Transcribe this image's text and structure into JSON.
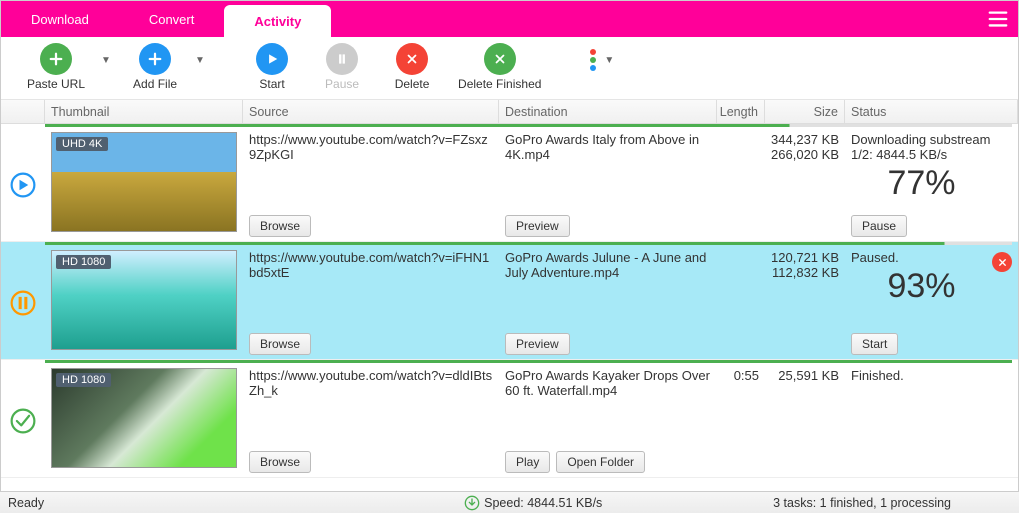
{
  "tabs": {
    "download": "Download",
    "convert": "Convert",
    "activity": "Activity"
  },
  "toolbar": {
    "pasteUrl": "Paste URL",
    "addFile": "Add File",
    "start": "Start",
    "pause": "Pause",
    "delete": "Delete",
    "deleteFinished": "Delete Finished"
  },
  "headers": {
    "thumbnail": "Thumbnail",
    "source": "Source",
    "destination": "Destination",
    "length": "Length",
    "size": "Size",
    "status": "Status"
  },
  "rows": [
    {
      "badge": "UHD 4K",
      "source": "https://www.youtube.com/watch?v=FZsxz9ZpKGI",
      "dest": "GoPro Awards  Italy from Above in 4K.mp4",
      "length": "",
      "size1": "344,237 KB",
      "size2": "266,020 KB",
      "statusText": "Downloading substream 1/2: 4844.5 KB/s",
      "pct": "77%",
      "browse": "Browse",
      "preview": "Preview",
      "action": "Pause",
      "progress": 77,
      "state": "playing",
      "selected": false
    },
    {
      "badge": "HD 1080",
      "source": "https://www.youtube.com/watch?v=iFHN1bd5xtE",
      "dest": "GoPro Awards  Julune - A June and July Adventure.mp4",
      "length": "",
      "size1": "120,721 KB",
      "size2": "112,832 KB",
      "statusText": "Paused.",
      "pct": "93%",
      "browse": "Browse",
      "preview": "Preview",
      "action": "Start",
      "progress": 93,
      "state": "paused",
      "selected": true
    },
    {
      "badge": "HD 1080",
      "source": "https://www.youtube.com/watch?v=dldIBtsZh_k",
      "dest": "GoPro Awards  Kayaker Drops Over 60 ft. Waterfall.mp4",
      "length": "0:55",
      "size1": "25,591 KB",
      "size2": "",
      "statusText": "Finished.",
      "pct": "",
      "browse": "Browse",
      "play": "Play",
      "openFolder": "Open Folder",
      "progress": 100,
      "state": "done",
      "selected": false
    }
  ],
  "statusbar": {
    "ready": "Ready",
    "speed": "Speed: 4844.51 KB/s",
    "tasks": "3 tasks: 1 finished, 1 processing"
  },
  "colors": {
    "brand": "#ff0099",
    "green": "#4caf50",
    "blue": "#2196f3",
    "red": "#f44336",
    "orange": "#ff9800"
  }
}
